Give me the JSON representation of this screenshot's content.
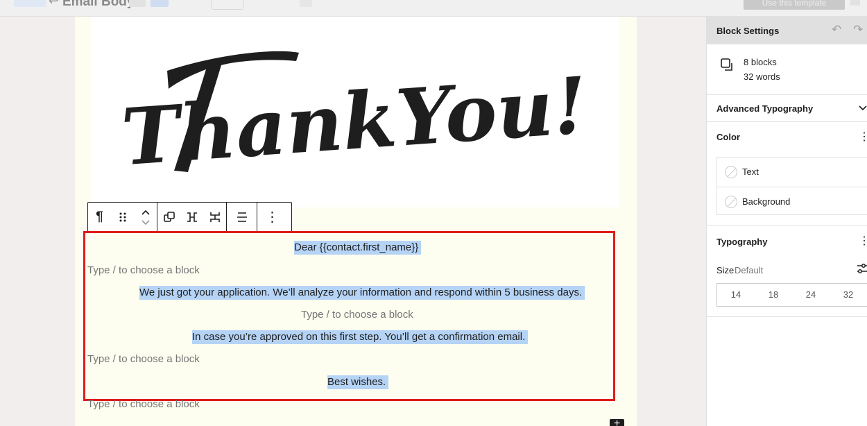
{
  "topbar": {
    "back_arrow": "↩",
    "title": "Email Body",
    "save_label": "Use this template"
  },
  "toolbar": {
    "paragraph_icon": "¶",
    "more_icon": "⋮"
  },
  "image": {
    "text": "ThankYou!"
  },
  "content": {
    "greeting": "Dear {{contact.first_name}}",
    "placeholder": "Type / to choose a block",
    "line1": "We just got your application. We’ll analyze your information and respond within 5 business days.",
    "line2": "In case you’re approved on this first step. You’ll get a confirmation email.",
    "line3": "Best wishes."
  },
  "add_button": "+",
  "sidebar": {
    "title": "Block Settings",
    "undo_icon": "↶",
    "redo_icon": "↷",
    "blocks_count": "8 blocks",
    "words_count": "32 words",
    "advanced_typography": "Advanced Typography",
    "color_title": "Color",
    "color_options": [
      "Text",
      "Background"
    ],
    "typography_title": "Typography",
    "size_label": "Size",
    "size_value": "Default",
    "sizes": [
      "14",
      "18",
      "24",
      "32"
    ],
    "menu_icon": "⋮"
  },
  "colors": {
    "highlight": "#e01b1b",
    "selection": "#b5d3f5",
    "email_background": "#fdfdf0"
  }
}
